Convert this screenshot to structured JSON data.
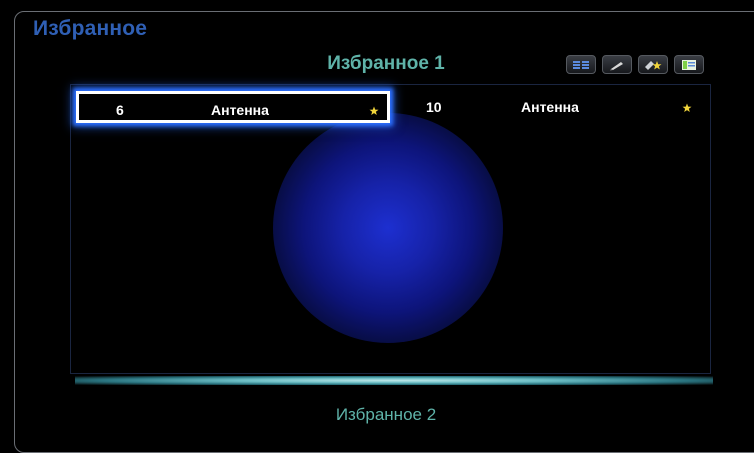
{
  "app": {
    "title": "Избранное"
  },
  "list": {
    "title": "Избранное 1"
  },
  "toolbar": {
    "buttons": [
      {
        "icon": "list-view-icon",
        "color": "#5b8be0"
      },
      {
        "icon": "edit-pen-icon",
        "color": "#d8d8d8"
      },
      {
        "icon": "add-favorite-icon",
        "color": "#f0d43a"
      },
      {
        "icon": "channel-info-icon",
        "color": "#9adf6a"
      }
    ]
  },
  "channels": [
    {
      "number": "6",
      "source": "Антенна",
      "favorite": "★",
      "selected": true
    },
    {
      "number": "10",
      "source": "Антенна",
      "favorite": "★",
      "selected": false
    }
  ],
  "next_list": {
    "title": "Избранное 2"
  },
  "colors": {
    "accent": "#2f5fb4",
    "teal": "#5fb3a9",
    "star": "#f0d43a",
    "focus": "#2c6fff"
  }
}
